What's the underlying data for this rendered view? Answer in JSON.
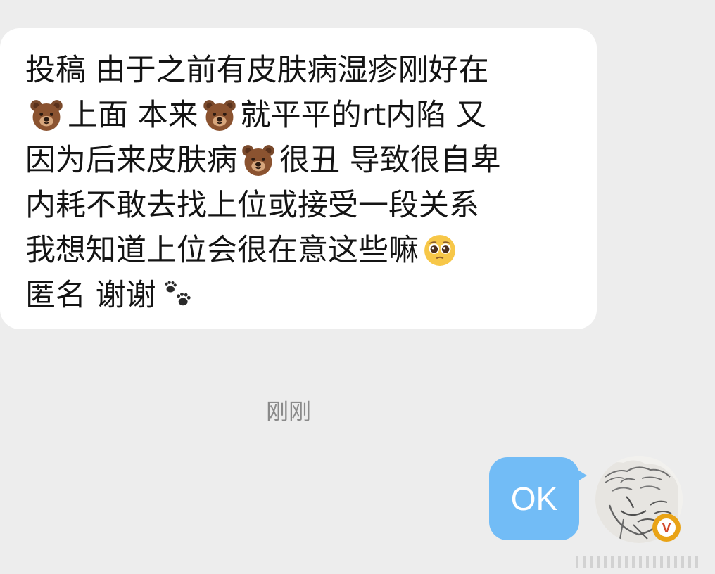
{
  "incoming_message": {
    "lines": [
      [
        "投稿  由于之前有皮肤病湿疹刚好在"
      ],
      [
        "",
        "上面 本来",
        "就平平的rt内陷  又"
      ],
      [
        "因为后来皮肤病",
        "很丑 导致很自卑"
      ],
      [
        "内耗不敢去找上位或接受一段关系"
      ],
      [
        "我想知道上位会很在意这些嘛"
      ],
      [
        "匿名  谢谢"
      ]
    ],
    "emoji_icons": [
      "bear-icon",
      "pleading-face-icon",
      "paw-prints-icon"
    ]
  },
  "timestamp": "刚刚",
  "outgoing_message": {
    "text": "OK"
  },
  "avatar": {
    "badge_letter": "V",
    "badge_color": "#e9a316",
    "badge_inner_color": "#d34b2d"
  },
  "colors": {
    "background": "#ededed",
    "incoming_bubble": "#ffffff",
    "outgoing_bubble": "#72bcf6",
    "text": "#141414",
    "timestamp": "#8a8a8a"
  }
}
